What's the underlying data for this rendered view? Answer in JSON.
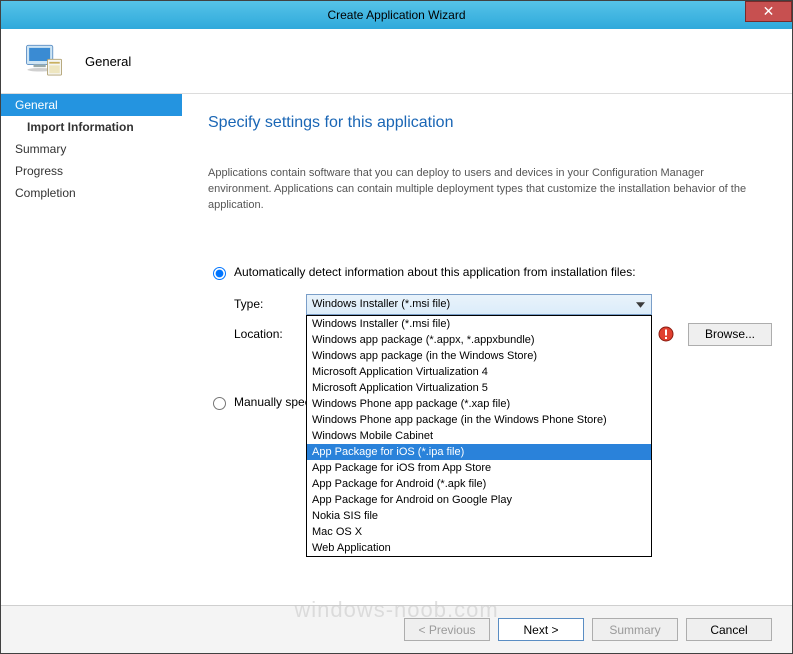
{
  "title": "Create Application Wizard",
  "header_label": "General",
  "sidebar": {
    "items": [
      {
        "label": "General",
        "active": true
      },
      {
        "label": "Import Information",
        "bold": true
      },
      {
        "label": "Summary"
      },
      {
        "label": "Progress"
      },
      {
        "label": "Completion"
      }
    ]
  },
  "content": {
    "heading": "Specify settings for this application",
    "description": "Applications contain software that you can deploy to users and devices in your Configuration Manager environment. Applications can contain multiple deployment types that customize the installation behavior of the application.",
    "radio_auto_label": "Automatically detect information about this application from installation files:",
    "radio_manual_label": "Manually specify the application information",
    "form": {
      "type_label": "Type:",
      "location_label": "Location:",
      "type_value": "Windows Installer (*.msi file)",
      "location_value": "",
      "browse_label": "Browse..."
    },
    "type_options": [
      "Windows Installer (*.msi file)",
      "Windows app package (*.appx, *.appxbundle)",
      "Windows app package (in the Windows Store)",
      "Microsoft Application Virtualization 4",
      "Microsoft Application Virtualization 5",
      "Windows Phone app package (*.xap file)",
      "Windows Phone app package (in the Windows Phone Store)",
      "Windows Mobile Cabinet",
      "App Package for iOS (*.ipa file)",
      "App Package for iOS from App Store",
      "App Package for Android (*.apk file)",
      "App Package for Android on Google Play",
      "Nokia SIS file",
      "Mac OS X",
      "Web Application"
    ],
    "highlighted_option_index": 8
  },
  "buttons": {
    "prev": "< Previous",
    "next": "Next >",
    "summary": "Summary",
    "cancel": "Cancel"
  },
  "watermark": "windows-noob.com"
}
